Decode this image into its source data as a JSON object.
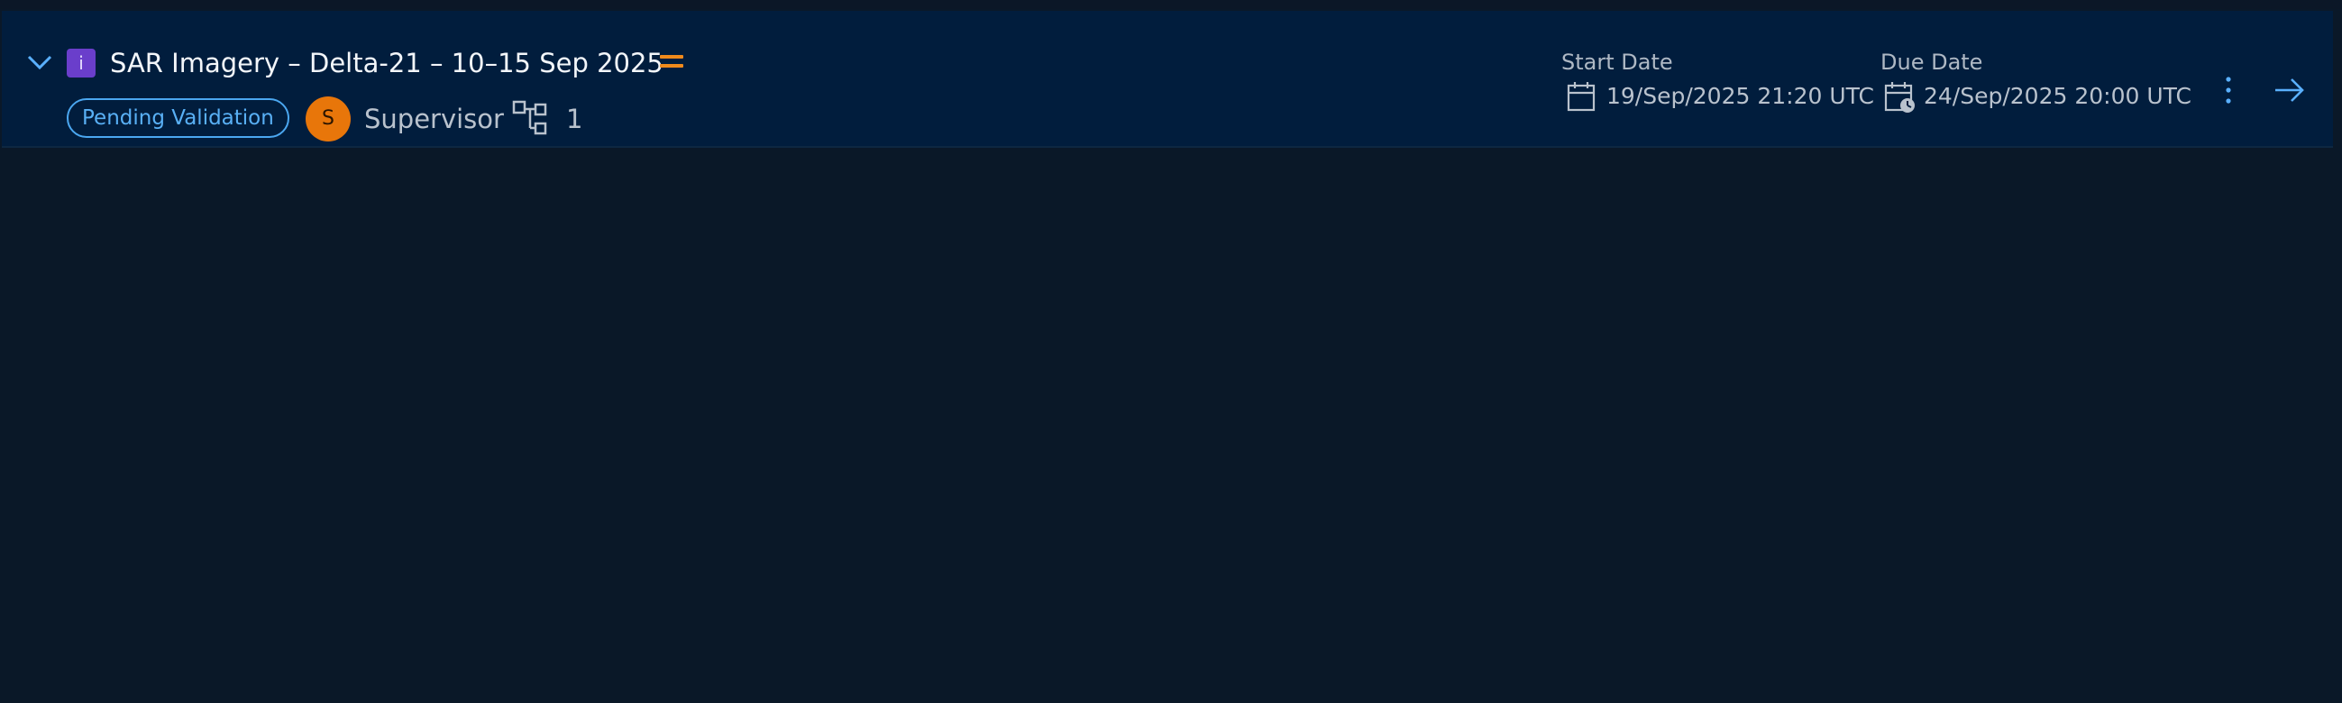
{
  "card": {
    "type_letter": "i",
    "title": "SAR Imagery – Delta-21 – 10–15 Sep 2025",
    "priority_icon": "equals-priority-icon",
    "status": "Pending Validation",
    "assignee_initial": "S",
    "assignee": "Supervisor",
    "subtask_count": "1",
    "start_label": "Start Date",
    "start_value": "19/Sep/2025 21:20 UTC",
    "due_label": "Due Date",
    "due_value": "24/Sep/2025 20:00 UTC"
  },
  "colors": {
    "background": "#0a1828",
    "card": "#011d3d",
    "type_badge": "#6a3ecb",
    "priority": "#f08a1c",
    "status": "#4ba7f0",
    "avatar": "#e8760a",
    "accent": "#5ab0ff"
  }
}
